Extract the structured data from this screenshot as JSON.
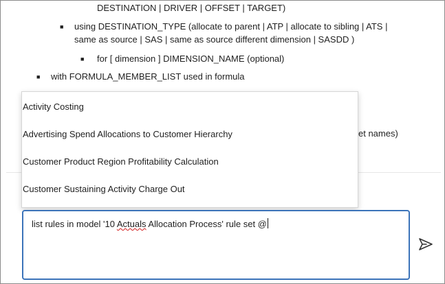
{
  "background_text": {
    "line1": "DESTINATION | DRIVER | OFFSET | TARGET)",
    "line2": "using DESTINATION_TYPE (allocate to parent | ATP | allocate to sibling | ATS |",
    "line3": "same as source | SAS | same as source different dimension | SASDD )",
    "line4": "for [ dimension ] DIMENSION_NAME (optional)",
    "line5": "with FORMULA_MEMBER_LIST used in formula",
    "peek": "et names)"
  },
  "suggestions": [
    "Activity Costing",
    "Advertising Spend Allocations to Customer Hierarchy",
    "Customer Product Region Profitability Calculation",
    "Customer Sustaining Activity Charge Out"
  ],
  "composer": {
    "text_before": "list rules in model '10 ",
    "misspelled_word": "Actuals",
    "text_after": " Allocation Process' rule set @"
  },
  "icons": {
    "send": "send-icon"
  },
  "colors": {
    "focus_border": "#3b73b9",
    "spellcheck": "#d11a1a"
  }
}
